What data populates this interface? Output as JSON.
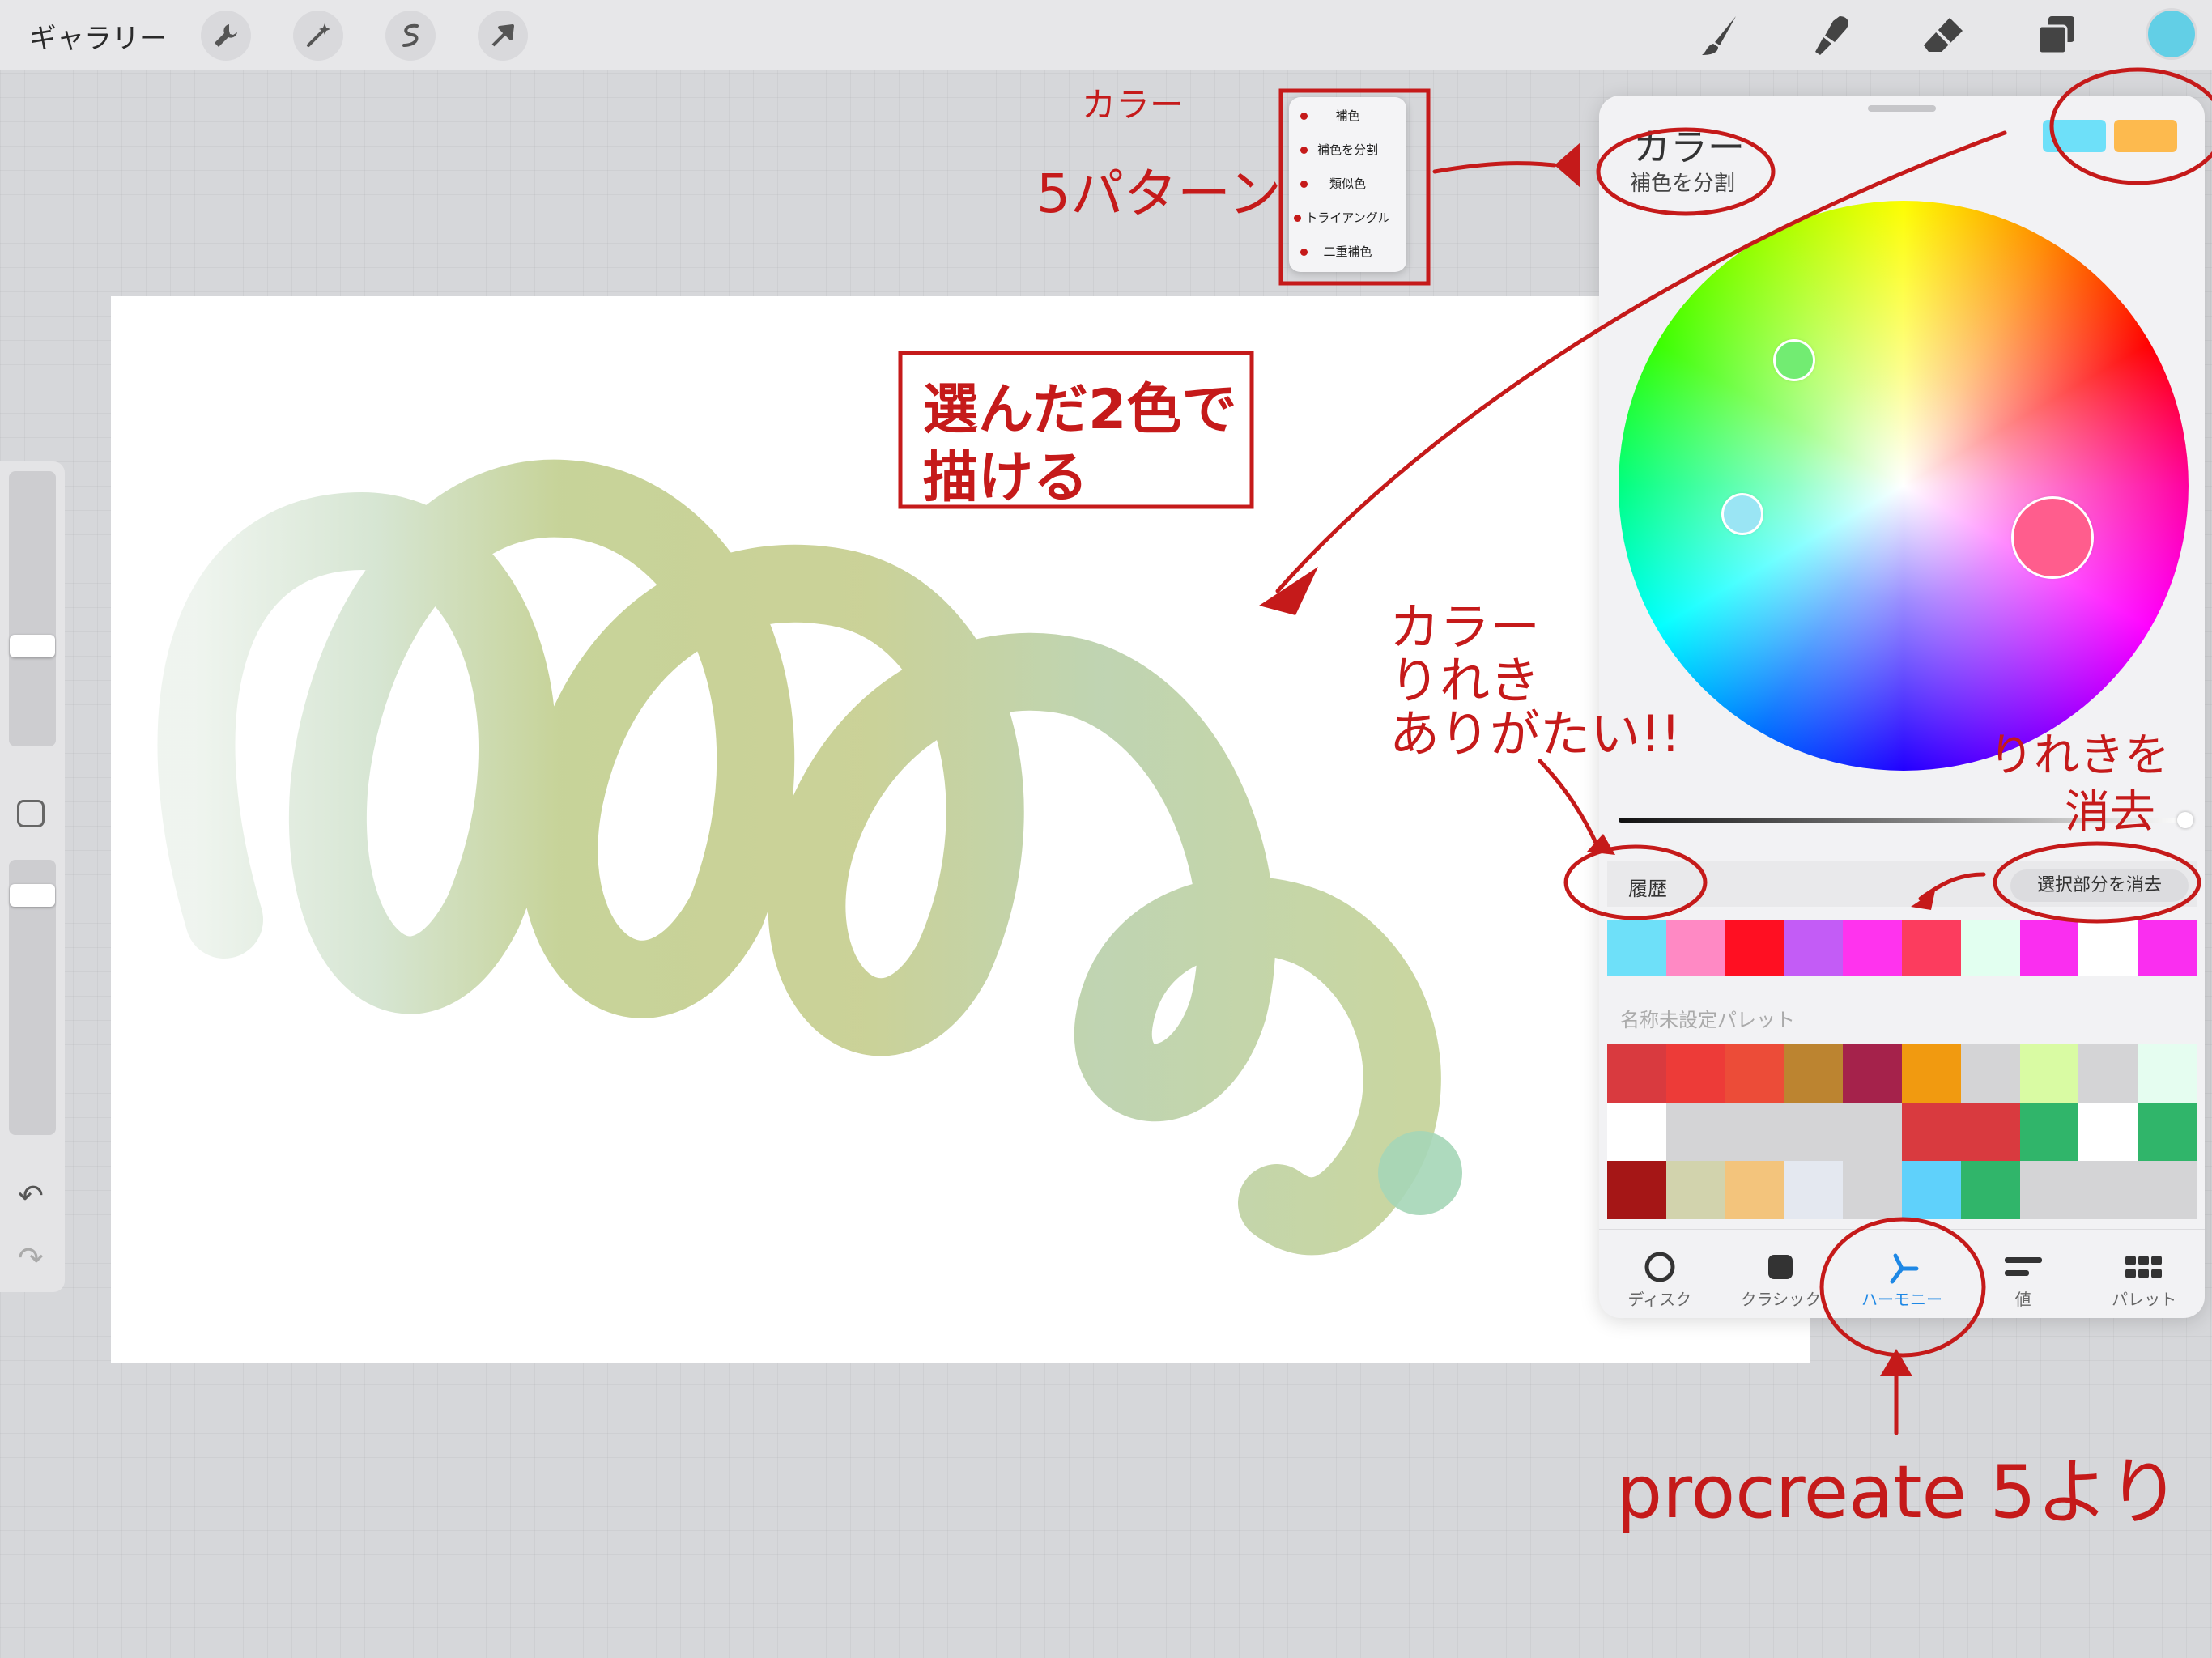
{
  "toolbar": {
    "gallery_label": "ギャラリー",
    "left_tools": [
      "wrench-icon",
      "magic-wand-icon",
      "selection-icon",
      "move-arrow-icon"
    ],
    "right_tools": [
      "brush-icon",
      "smudge-icon",
      "eraser-icon",
      "layers-icon",
      "color-icon"
    ],
    "current_color": "#62cfe6"
  },
  "panel": {
    "title": "カラー",
    "mode": "補色を分割",
    "top_swatches": [
      "#6ee0f9",
      "#fdba4e"
    ],
    "history_label": "履歴",
    "clear_label": "選択部分を消去",
    "history_colors": [
      "#6ee0f9",
      "#ff89c4",
      "#ff0f22",
      "#c35cf6",
      "#ff33ee",
      "#fc3c5e",
      "#e2fff0",
      "#fa2ef0",
      "#ffffff",
      "#fa2ef0"
    ],
    "palette_label": "名称未設定パレット",
    "palette_colors": [
      "#d93a3f",
      "#ed3b38",
      "#ec4c38",
      "#bc8430",
      "#a5224b",
      "#f19a10",
      "#d4d4d6",
      "#d9fba3",
      "#d4d4d6",
      "#e5fdf0",
      "#ffffff",
      "#d4d4d6",
      "#d4d4d6",
      "#d4d4d6",
      "#d4d4d6",
      "#d93a3f",
      "#d93a3f",
      "#30b56a",
      "#ffffff",
      "#30b56a",
      "#a51616",
      "#d2d3ad",
      "#f3c47c",
      "#e4e8f0",
      "#d4d4d6",
      "#5fd1fb",
      "#30b56a",
      "#d4d4d6",
      "#d4d4d6",
      "#d4d4d6"
    ],
    "tabs": [
      {
        "label": "ディスク",
        "icon": "disc-icon"
      },
      {
        "label": "クラシック",
        "icon": "square-icon"
      },
      {
        "label": "ハーモニー",
        "icon": "harmony-icon"
      },
      {
        "label": "値",
        "icon": "sliders-icon"
      },
      {
        "label": "パレット",
        "icon": "palette-grid-icon"
      }
    ],
    "handle_colors": [
      "#72ec72",
      "#9ae5f4",
      "#ff5d8d"
    ]
  },
  "popup": {
    "items": [
      "補色",
      "補色を分割",
      "類似色",
      "トライアングル",
      "二重補色"
    ]
  },
  "annotations": {
    "color_label": "カラー",
    "patterns": "5パターン",
    "draw_line1": "選んだ2色で",
    "draw_line2": "描ける",
    "history_line1": "カラー",
    "history_line2": "りれき",
    "history_line3": "ありがたい!!",
    "clear_line1": "りれきを",
    "clear_line2": "消去",
    "procreate": "procreate 5より"
  }
}
